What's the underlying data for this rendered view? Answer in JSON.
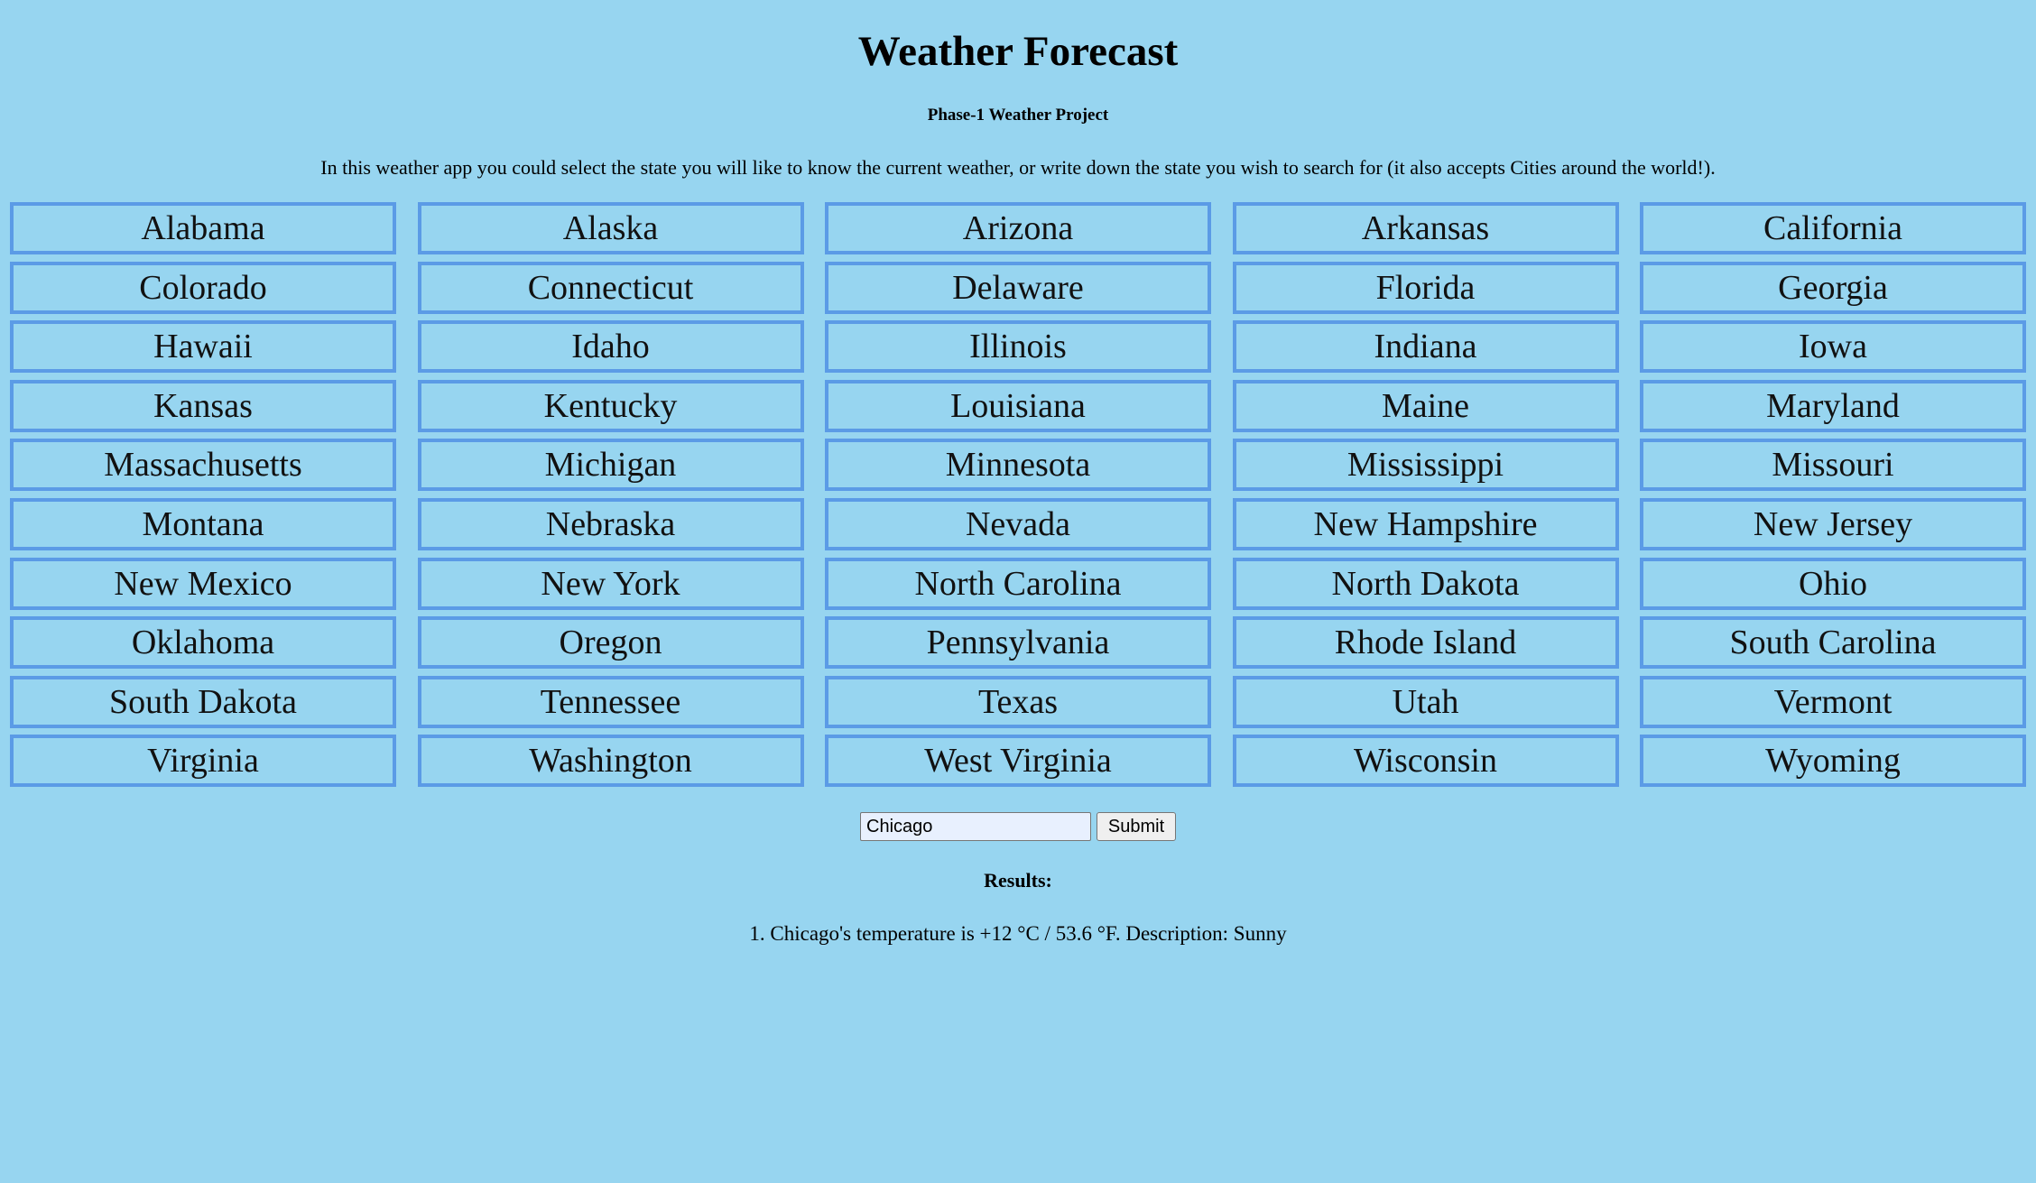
{
  "header": {
    "title": "Weather Forecast",
    "subtitle": "Phase-1 Weather Project",
    "intro": "In this weather app you could select the state you will like to know the current weather, or write down the state you wish to search for (it also accepts Cities around the world!)."
  },
  "states": [
    "Alabama",
    "Alaska",
    "Arizona",
    "Arkansas",
    "California",
    "Colorado",
    "Connecticut",
    "Delaware",
    "Florida",
    "Georgia",
    "Hawaii",
    "Idaho",
    "Illinois",
    "Indiana",
    "Iowa",
    "Kansas",
    "Kentucky",
    "Louisiana",
    "Maine",
    "Maryland",
    "Massachusetts",
    "Michigan",
    "Minnesota",
    "Mississippi",
    "Missouri",
    "Montana",
    "Nebraska",
    "Nevada",
    "New Hampshire",
    "New Jersey",
    "New Mexico",
    "New York",
    "North Carolina",
    "North Dakota",
    "Ohio",
    "Oklahoma",
    "Oregon",
    "Pennsylvania",
    "Rhode Island",
    "South Carolina",
    "South Dakota",
    "Tennessee",
    "Texas",
    "Utah",
    "Vermont",
    "Virginia",
    "Washington",
    "West Virginia",
    "Wisconsin",
    "Wyoming"
  ],
  "search": {
    "value": "Chicago",
    "submit_label": "Submit"
  },
  "results": {
    "heading": "Results:",
    "lines": [
      "1. Chicago's temperature is +12 °C / 53.6 °F. Description: Sunny"
    ]
  },
  "colors": {
    "background": "#97d5f0",
    "button_border": "#5b9be6",
    "input_background": "#e8f0fe"
  }
}
